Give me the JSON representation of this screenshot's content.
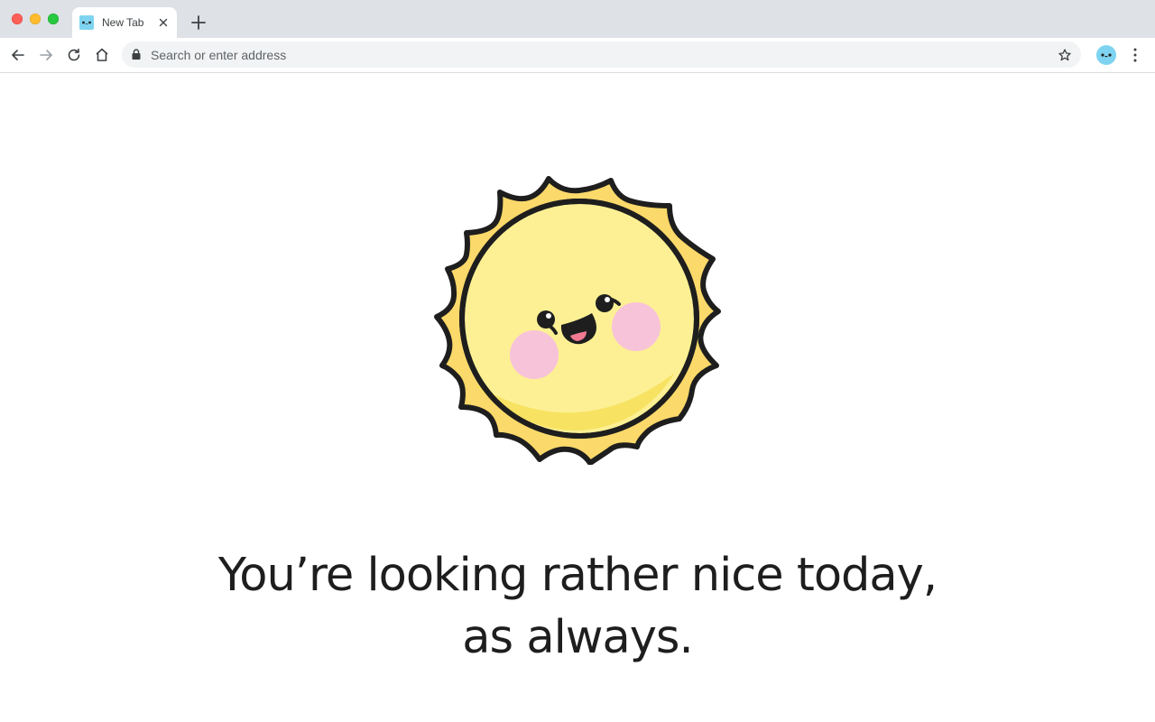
{
  "browser": {
    "tab": {
      "title": "New Tab",
      "favicon": "sun-face-icon"
    },
    "new_tab_icon": "plus-icon",
    "address_bar": {
      "placeholder": "Search or enter address",
      "lock_icon": "lock-icon",
      "bookmark_icon": "star-icon"
    },
    "nav": {
      "back_icon": "arrow-left-icon",
      "forward_icon": "arrow-right-icon",
      "reload_icon": "reload-icon",
      "home_icon": "home-icon"
    },
    "profile_icon": "profile-avatar-icon",
    "menu_icon": "kebab-menu-icon",
    "colors": {
      "titlebar": "#dee1e6",
      "accent": "#7ed4f0"
    }
  },
  "page": {
    "illustration": "smiling-sun-illustration",
    "message_line1": "You’re looking rather nice today,",
    "message_line2": "as always.",
    "colors": {
      "sun_face": "#fdf094",
      "sun_rays": "#fbd96a",
      "cheeks": "#f7c3d9",
      "text": "#1e1e1e"
    }
  }
}
